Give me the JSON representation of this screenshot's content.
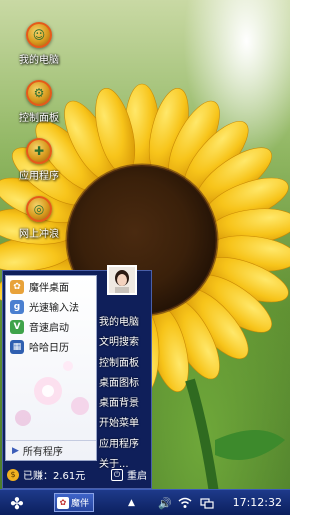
{
  "desktop": {
    "icons": [
      {
        "label": "我的电脑",
        "glyph": "computer-icon"
      },
      {
        "label": "控制面板",
        "glyph": "control-panel-icon"
      },
      {
        "label": "应用程序",
        "glyph": "applications-icon"
      },
      {
        "label": "网上冲浪",
        "glyph": "internet-icon"
      }
    ]
  },
  "start_menu": {
    "apps": [
      {
        "name": "魔伴桌面",
        "icon": "pinwheel-icon",
        "color": "#e8a23a"
      },
      {
        "name": "光速输入法",
        "icon": "keyboard-g-icon",
        "color": "#4a7fd0"
      },
      {
        "name": "音速启动",
        "icon": "v-launcher-icon",
        "color": "#3fa34a"
      },
      {
        "name": "哈哈日历",
        "icon": "calendar-icon",
        "color": "#2f5fb0"
      }
    ],
    "all_programs": "所有程序",
    "right_items": [
      "我的电脑",
      "文明搜索",
      "控制面板",
      "桌面图标",
      "桌面背景",
      "开始菜单",
      "应用程序",
      "关于..."
    ],
    "earned": "已赚：2.61元",
    "restart": "重启"
  },
  "taskbar": {
    "task_label": "魔伴",
    "time": "17:12:32"
  }
}
